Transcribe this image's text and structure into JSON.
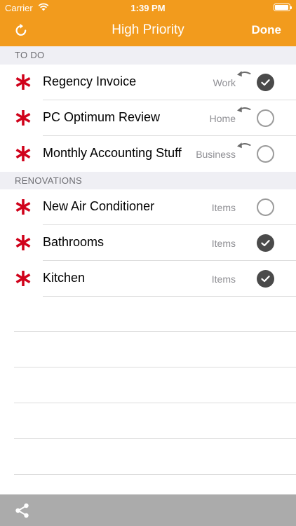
{
  "status_bar": {
    "carrier": "Carrier",
    "time": "1:39 PM"
  },
  "nav": {
    "title": "High Priority",
    "done_label": "Done",
    "left_icon": "refresh-icon"
  },
  "sections": [
    {
      "header": "TO DO",
      "rows": [
        {
          "title": "Regency Invoice",
          "category": "Work",
          "completed": true,
          "has_undo": true
        },
        {
          "title": "PC Optimum Review",
          "category": "Home",
          "completed": false,
          "has_undo": true
        },
        {
          "title": "Monthly Accounting Stuff",
          "category": "Business",
          "completed": false,
          "has_undo": true
        }
      ]
    },
    {
      "header": "RENOVATIONS",
      "rows": [
        {
          "title": "New Air Conditioner",
          "category": "Items",
          "completed": false,
          "has_undo": false
        },
        {
          "title": "Bathrooms",
          "category": "Items",
          "completed": true,
          "has_undo": false
        },
        {
          "title": "Kitchen",
          "category": "Items",
          "completed": true,
          "has_undo": false
        }
      ]
    }
  ],
  "bottom_bar": {
    "icon": "share-icon"
  },
  "colors": {
    "accent": "#F29B1D",
    "priority_star": "#D0021B",
    "check_filled": "#4A4A4A",
    "bottom_bar": "#ABABAB"
  }
}
